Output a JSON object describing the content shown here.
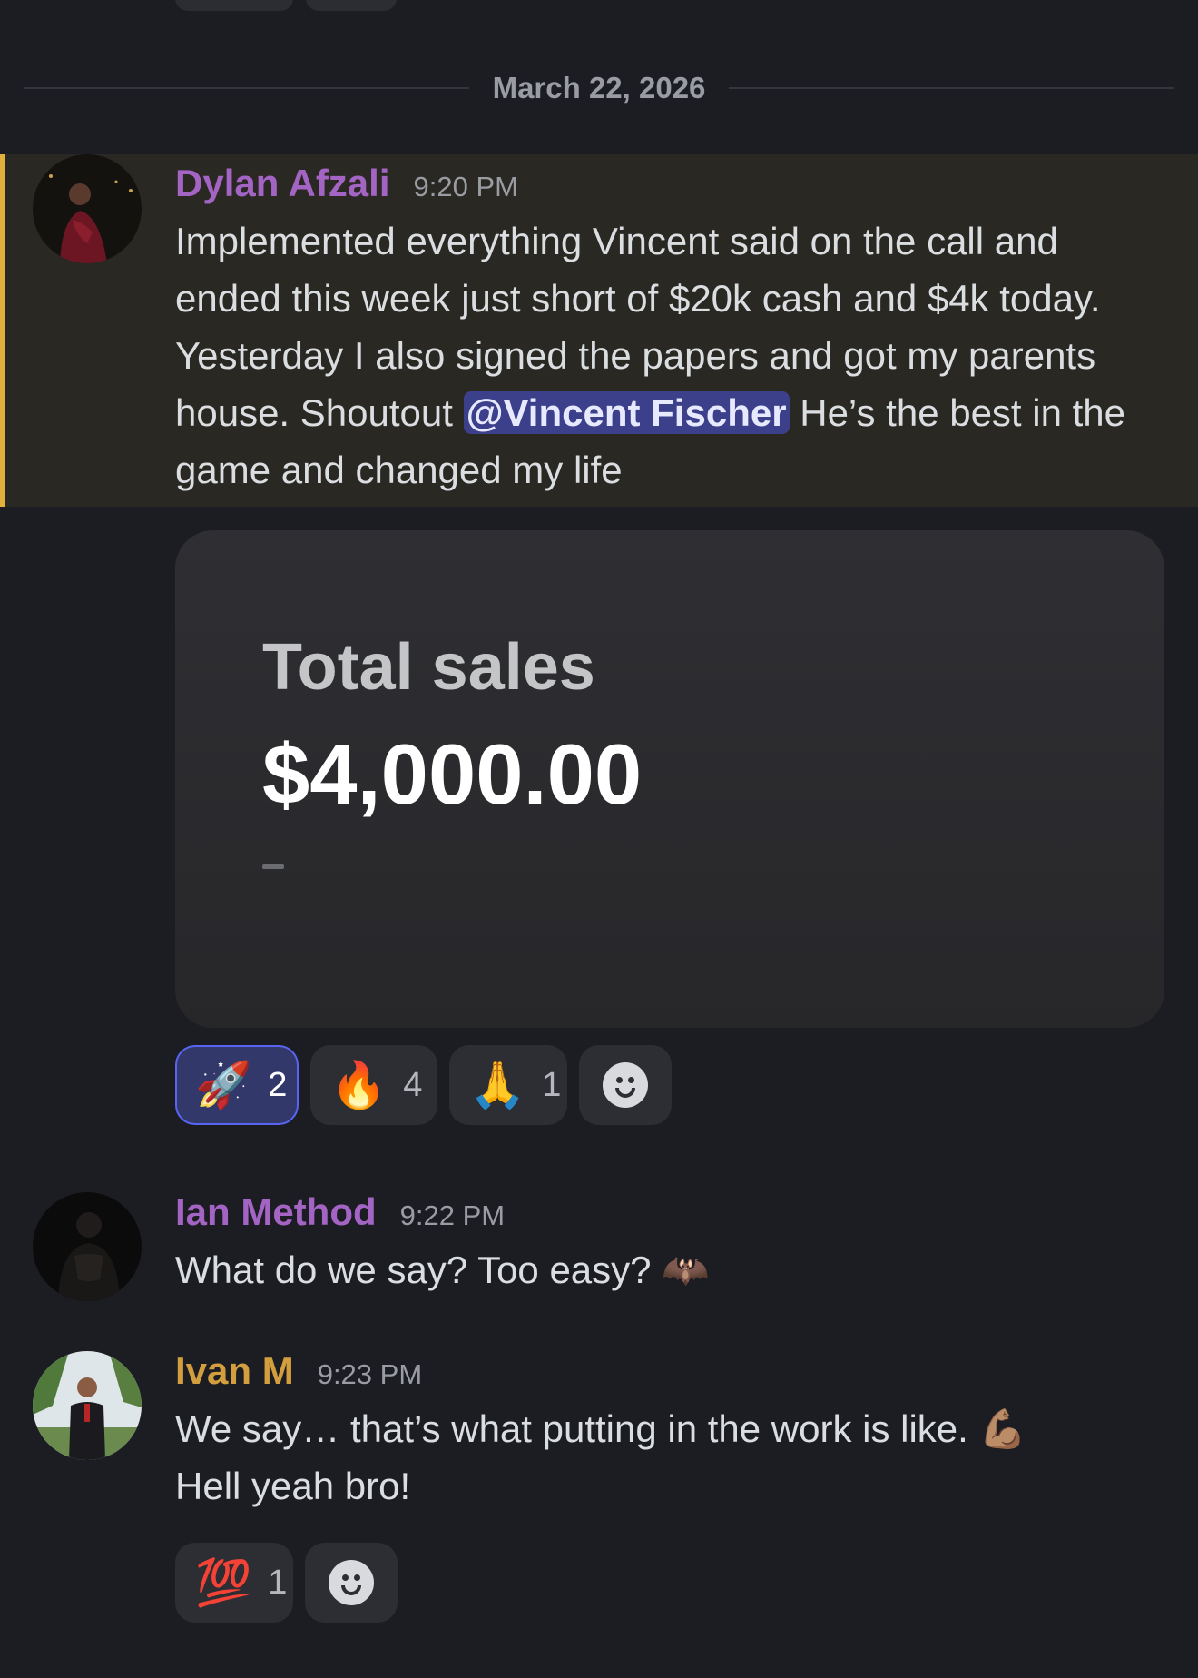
{
  "date_divider": "March 22, 2026",
  "messages": [
    {
      "author": "Dylan Afzali",
      "author_color": "#a364c4",
      "time": "9:20 PM",
      "text_before": "Implemented everything Vincent said on the call and ended this week just short of $20k cash and $4k today. Yesterday I also signed the papers and got my parents house. Shoutout ",
      "mention": "@Vincent Fischer",
      "text_after": " He’s the best in the game and changed my life",
      "embed": {
        "label": "Total sales",
        "amount": "$4,000.00",
        "sub": "-"
      },
      "reactions": [
        {
          "emoji": "🚀",
          "icon": "rocket-emoji",
          "count": "2",
          "selected": true
        },
        {
          "emoji": "🔥",
          "icon": "fire-emoji",
          "count": "4",
          "selected": false
        },
        {
          "emoji": "🙏",
          "icon": "pray-emoji",
          "count": "1",
          "selected": false
        }
      ]
    },
    {
      "author": "Ian Method",
      "author_color": "#a364c4",
      "time": "9:22 PM",
      "text": "What do we say? Too easy?",
      "emoji": "🦇"
    },
    {
      "author": "Ivan M",
      "author_color": "#d39f3e",
      "time": "9:23 PM",
      "text_line1": "We say… that’s what putting in the work is like.",
      "emoji": "💪🏽",
      "text_line2": "Hell yeah bro!",
      "reactions": [
        {
          "emoji": "💯",
          "icon": "hundred-emoji",
          "count": "1",
          "selected": false
        }
      ]
    }
  ],
  "add_reaction_icon": "add-reaction-icon"
}
